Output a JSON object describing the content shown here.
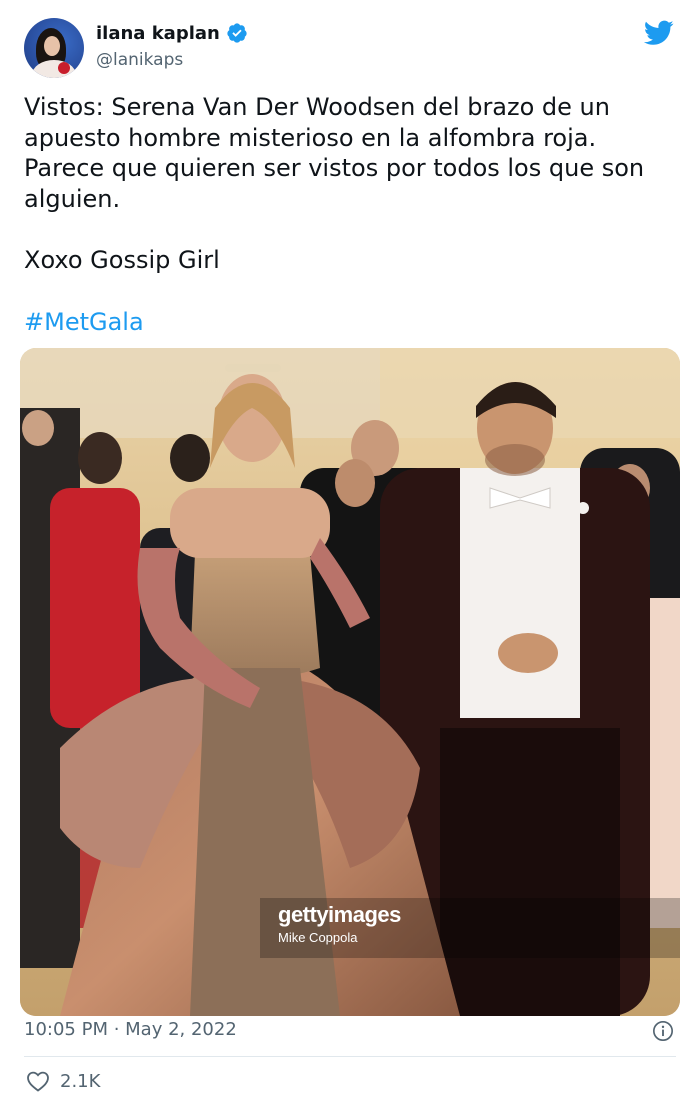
{
  "author": {
    "display_name": "ilana kaplan",
    "handle": "@lanikaps",
    "verified": true
  },
  "tweet": {
    "text": "Vistos: Serena Van Der Woodsen del brazo de un apuesto hombre misterioso en la alfombra roja. Parece que quieren ser vistos por todos los que son alguien.\n\nXoxo Gossip Girl",
    "hashtag": "#MetGala"
  },
  "media": {
    "watermark_logo": "gettyimages",
    "watermark_credit": "Mike Coppola"
  },
  "meta": {
    "timestamp": "10:05 PM · May 2, 2022",
    "like_count": "2.1K"
  },
  "colors": {
    "accent": "#1d9bf0",
    "text": "#0f1419",
    "secondary": "#536471"
  },
  "icons": [
    "verified-badge-icon",
    "twitter-bird-icon",
    "info-icon",
    "heart-icon"
  ]
}
